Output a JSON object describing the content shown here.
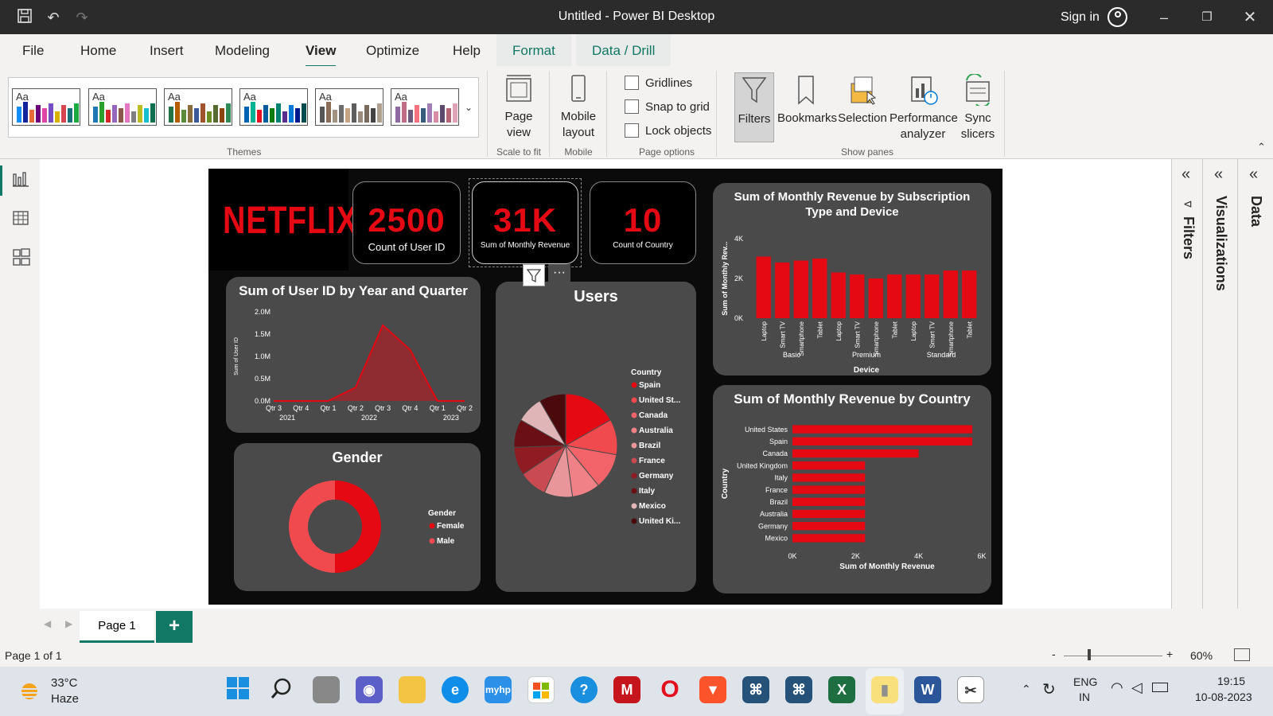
{
  "window": {
    "title": "Untitled - Power BI Desktop",
    "sign_in": "Sign in"
  },
  "menu": {
    "items": [
      "File",
      "Home",
      "Insert",
      "Modeling",
      "View",
      "Optimize",
      "Help"
    ],
    "contextual": [
      "Format",
      "Data / Drill"
    ],
    "active": "View"
  },
  "ribbon": {
    "themes_label": "Themes",
    "theme_aa": "Aa",
    "page_view": "Page view",
    "scale_to_fit": "Scale to fit",
    "mobile_layout": "Mobile layout",
    "mobile": "Mobile",
    "gridlines": "Gridlines",
    "snap_to_grid": "Snap to grid",
    "lock_objects": "Lock objects",
    "page_options": "Page options",
    "filters": "Filters",
    "bookmarks": "Bookmarks",
    "selection": "Selection",
    "performance_analyzer": "Performance analyzer",
    "sync_slicers": "Sync slicers",
    "show_panes": "Show panes"
  },
  "report": {
    "logo": "NETFLIX",
    "kpis": [
      {
        "value": "2500",
        "label": "Count of User ID"
      },
      {
        "value": "31K",
        "label": "Sum of Monthly Revenue"
      },
      {
        "value": "10",
        "label": "Count of Country"
      }
    ],
    "pie_title": "Users",
    "donut_title": "Gender"
  },
  "chart_data": [
    {
      "type": "area",
      "title": "Sum of User ID by Year and Quarter",
      "ylabel": "Sum of User ID",
      "y_ticks": [
        "0.0M",
        "0.5M",
        "1.0M",
        "1.5M",
        "2.0M"
      ],
      "ylim": [
        0,
        2.0
      ],
      "x": [
        "Qtr 3",
        "Qtr 4",
        "Qtr 1",
        "Qtr 2",
        "Qtr 3",
        "Qtr 4",
        "Qtr 1",
        "Qtr 2"
      ],
      "x_groups": [
        "2021",
        "2022",
        "2023"
      ],
      "values": [
        0,
        0,
        0,
        0.3,
        1.7,
        1.15,
        0,
        0
      ],
      "color": "#e50914"
    },
    {
      "type": "bar",
      "title": "Sum of Monthly Revenue by Subscription Type and Device",
      "xlabel": "Device",
      "ylabel": "Sum of Monthly Rev...",
      "y_ticks": [
        "0K",
        "2K",
        "4K"
      ],
      "ylim": [
        0,
        4
      ],
      "categories": [
        "Laptop",
        "Smart TV",
        "Smartphone",
        "Tablet",
        "Laptop",
        "Smart TV",
        "Smartphone",
        "Tablet",
        "Laptop",
        "Smart TV",
        "Smartphone",
        "Tablet"
      ],
      "groups": [
        "Basic",
        "Premium",
        "Standard"
      ],
      "values": [
        3.1,
        2.8,
        2.9,
        3.0,
        2.3,
        2.2,
        2.0,
        2.2,
        2.2,
        2.2,
        2.4,
        2.4
      ],
      "color": "#e50914"
    },
    {
      "type": "bar",
      "orientation": "horizontal",
      "title": "Sum of Monthly Revenue by Country",
      "xlabel": "Sum of Monthly Revenue",
      "ylabel": "Country",
      "x_ticks": [
        "0K",
        "2K",
        "4K",
        "6K"
      ],
      "xlim": [
        0,
        6
      ],
      "categories": [
        "United States",
        "Spain",
        "Canada",
        "United Kingdom",
        "Italy",
        "France",
        "Brazil",
        "Australia",
        "Germany",
        "Mexico"
      ],
      "values": [
        5.7,
        5.7,
        4.0,
        2.3,
        2.3,
        2.3,
        2.3,
        2.3,
        2.3,
        2.3
      ],
      "color": "#e50914"
    },
    {
      "type": "pie",
      "title": "Users",
      "legend_title": "Country",
      "categories": [
        "Spain",
        "United St...",
        "Canada",
        "Australia",
        "Brazil",
        "France",
        "Germany",
        "Italy",
        "Mexico",
        "United Ki..."
      ],
      "values": [
        18,
        12,
        12,
        9.5,
        9.5,
        9.5,
        9.5,
        9.5,
        9,
        9
      ],
      "colors": [
        "#e50914",
        "#f04a4f",
        "#f26469",
        "#f08186",
        "#e8969a",
        "#c94a50",
        "#8e1c22",
        "#6a0f14",
        "#e0b5b8",
        "#4a0a0d"
      ]
    },
    {
      "type": "pie",
      "title": "Gender",
      "donut": true,
      "legend_title": "Gender",
      "categories": [
        "Female",
        "Male"
      ],
      "values": [
        50,
        50
      ],
      "colors": [
        "#e50914",
        "#f04a4f"
      ]
    }
  ],
  "panes": {
    "filters": "Filters",
    "visualizations": "Visualizations",
    "data": "Data"
  },
  "pages": {
    "tab": "Page 1",
    "add": "+"
  },
  "status": {
    "page_count": "Page 1 of 1",
    "zoom": "60%",
    "minus": "-",
    "plus": "+"
  },
  "taskbar": {
    "weather_temp": "33°C",
    "weather_desc": "Haze",
    "lang": "ENG",
    "region": "IN",
    "time": "19:15",
    "date": "10-08-2023"
  }
}
